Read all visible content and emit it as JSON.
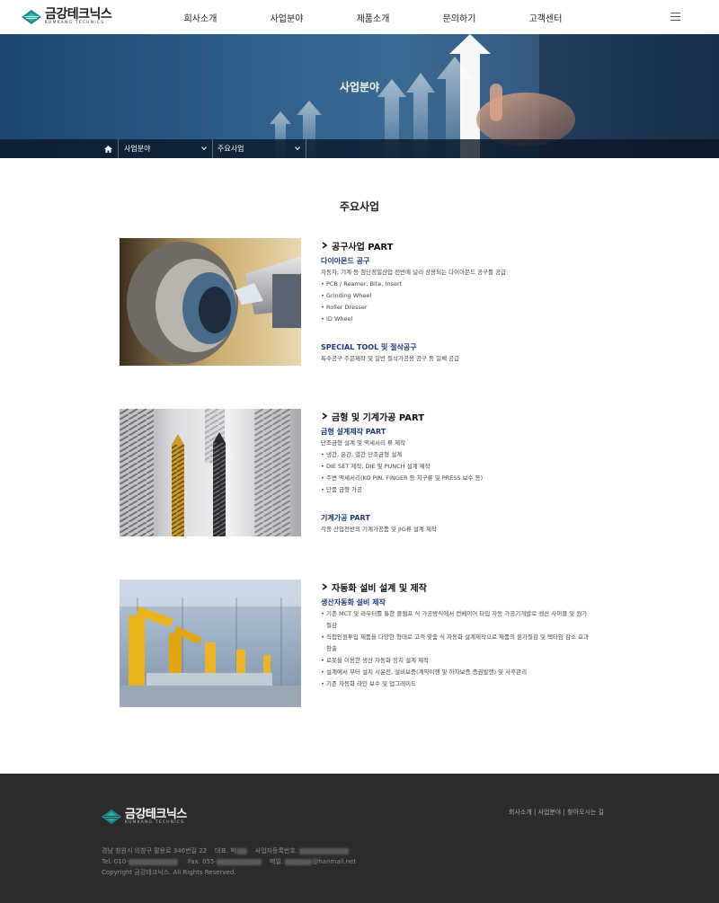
{
  "header": {
    "logo_ko": "금강테크닉스",
    "logo_en": "KUMKANG TECHNICS",
    "nav": [
      "회사소개",
      "사업분야",
      "제품소개",
      "문의하기",
      "고객센터"
    ]
  },
  "hero": {
    "title": "사업분야",
    "breadcrumb": [
      "사업분야",
      "주요사업"
    ]
  },
  "main": {
    "title": "주요사업",
    "sections": [
      {
        "heading": "공구사업 PART",
        "groups": [
          {
            "title": "다이아몬드 공구",
            "desc": "자동차, 기계 등 첨단정밀산업 전반에 널리 상용되는 다이아몬드 공구를 공급",
            "bullets": [
              "PCB / Reamer, Bite, Insert",
              "Grinding Wheel",
              "Roller Dresser",
              "ID Wheel"
            ]
          },
          {
            "title": "SPECIAL TOOL 및 절삭공구",
            "desc": "특수공구 주문제작 및 일반 절삭가공용 공구 등 일체 공급",
            "bullets": []
          }
        ]
      },
      {
        "heading": "금형 및 기계가공 PART",
        "groups": [
          {
            "title": "금형 설계제작 PART",
            "desc": "단조금형 설계 및 액세서리 류 제작",
            "bullets": [
              "냉간, 온간, 열간 단조금형 설계",
              "DIE SET 제작, DIE 및 PUNCH 설계 제작",
              "주변 액세서리(KO PIN, FINGER 등 치구류 및 PRESS 보수 등)",
              "단품 금형 가공"
            ]
          },
          {
            "title": "기계가공 PART",
            "desc": "각종 산업전반의 기계가공품  및 JIG류 설계 제작",
            "bullets": []
          }
        ]
      },
      {
        "heading": "자동화 설비 설계 및 제작",
        "groups": [
          {
            "title": "생산자동화 설비 제작",
            "desc": "",
            "bullets": [
              "기존 MCT 및 라우터를 통한 클램프 식 가공방식에서 컨베이어 타입 자동 가공기개발로 생산 사이클 및 원가절감",
              "직접인원투입 제품을 다양한 형태로 고객 맞춤 식 자동화 설계제작으로 제품의 원가절감 및 택타임 감소 효과창출",
              "로봇을 이용한 생산 자동화 장치 설계 제작",
              "설계에서 부터 설치 시운전, 설비보증(계약이행 및 하자보증 증권발행) 및 사후관리",
              "기존 자동화 라인 보수 및 업그레이드"
            ]
          }
        ]
      }
    ]
  },
  "footer": {
    "logo_ko": "금강테크닉스",
    "logo_en": "KUMKANG TECHNICS",
    "links": "회사소개  |  사업분야  |  찾아오시는 길",
    "address": "경남 창원시 의창구 팔용로 346번길 22",
    "ceo_label": "대표. 박",
    "biz_label": "사업자등록번호.",
    "tel_label": "Tel. 010-",
    "fax_label": "Fax. 055-",
    "email_label": "메일.",
    "email_domain": "@hanmail.net",
    "copyright": "Copyright 금강테크닉스. All Rights Reserved."
  },
  "colors": {
    "accent": "#1f3a7a",
    "footer_bg": "#2c2c2c",
    "hero_blue": "#2f5f89"
  }
}
